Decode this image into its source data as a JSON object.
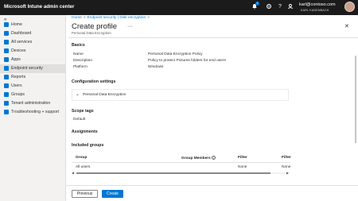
{
  "app": {
    "title": "Microsoft Intune admin center",
    "account_email": "karl@contoso.com",
    "account_tenant": "KARL KADENBACH",
    "notification_count": "1",
    "header_icons": [
      "bell-icon",
      "gear-icon",
      "help-icon",
      "feedback-icon"
    ]
  },
  "sidebar": {
    "collapse_glyph": "«",
    "items": [
      {
        "label": "Home",
        "icon": "home-icon",
        "color": "#0078d4"
      },
      {
        "label": "Dashboard",
        "icon": "dashboard-icon",
        "color": "#0078d4"
      },
      {
        "label": "All services",
        "icon": "all-services-icon",
        "color": "#0078d4"
      },
      {
        "label": "Devices",
        "icon": "devices-icon",
        "color": "#0078d4"
      },
      {
        "label": "Apps",
        "icon": "apps-icon",
        "color": "#0078d4"
      },
      {
        "label": "Endpoint security",
        "icon": "endpoint-security-icon",
        "color": "#0078d4"
      },
      {
        "label": "Reports",
        "icon": "reports-icon",
        "color": "#0078d4"
      },
      {
        "label": "Users",
        "icon": "users-icon",
        "color": "#0078d4"
      },
      {
        "label": "Groups",
        "icon": "groups-icon",
        "color": "#0078d4"
      },
      {
        "label": "Tenant administration",
        "icon": "tenant-admin-icon",
        "color": "#0078d4"
      },
      {
        "label": "Troubleshooting + support",
        "icon": "troubleshooting-icon",
        "color": "#0078d4"
      }
    ],
    "active_index": 5
  },
  "breadcrumb": [
    "Home",
    "Endpoint security | Disk encryption"
  ],
  "page": {
    "title": "Create profile",
    "subtitle": "Personal Data Encryption",
    "more_glyph": "···",
    "close_glyph": "✕"
  },
  "basics": {
    "title": "Basics",
    "rows": [
      {
        "label": "Name",
        "value": "Personal Data Encryption Policy"
      },
      {
        "label": "Description",
        "value": "Policy to protect Pictures folders for end users"
      },
      {
        "label": "Platform",
        "value": "Windows"
      }
    ]
  },
  "configuration": {
    "title": "Configuration settings",
    "expander_label": "Personal Data Encryption"
  },
  "scope": {
    "title": "Scope tags",
    "value": "Default"
  },
  "assignments": {
    "title": "Assignments",
    "included_title": "Included groups",
    "columns": [
      "Group",
      "Group Members",
      "Filter",
      "Filter"
    ],
    "rows": [
      {
        "group": "All users",
        "members": "",
        "filter": "None",
        "filter_mode": "None"
      }
    ],
    "scroll_fraction": 0.93
  },
  "footer": {
    "previous_label": "Previous",
    "create_label": "Create"
  },
  "colors": {
    "accent": "#0078d4",
    "topbar": "#1b1b1b",
    "sidebar": "#f3f2f1"
  }
}
